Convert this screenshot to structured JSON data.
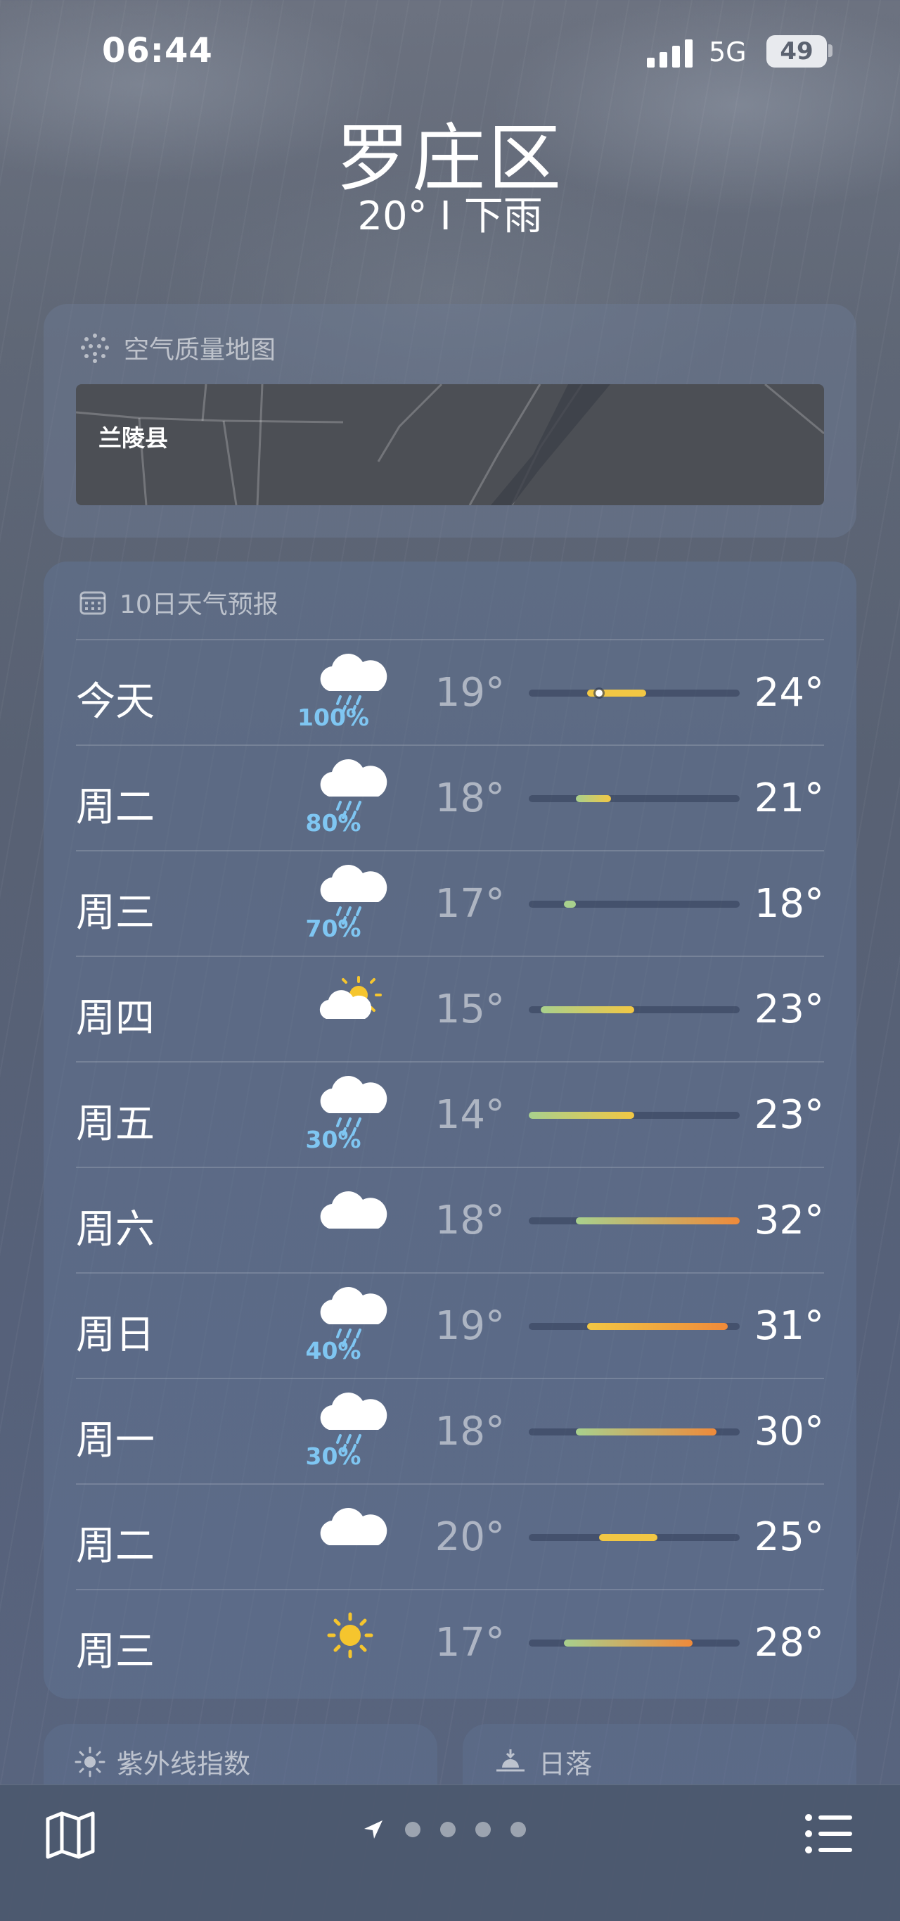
{
  "status": {
    "time": "06:44",
    "network": "5G",
    "battery": "49"
  },
  "location": {
    "city": "罗庄区",
    "condition": "20°  I  下雨"
  },
  "air_quality": {
    "title": "空气质量地图",
    "map_label": "兰陵县"
  },
  "forecast": {
    "title": "10日天气预报",
    "days": [
      {
        "day": "今天",
        "icon": "rain-cloud-icon",
        "precip": "100%",
        "low": "19°",
        "high": "24°"
      },
      {
        "day": "周二",
        "icon": "rain-cloud-icon",
        "precip": "80%",
        "low": "18°",
        "high": "21°"
      },
      {
        "day": "周三",
        "icon": "rain-cloud-icon",
        "precip": "70%",
        "low": "17°",
        "high": "18°"
      },
      {
        "day": "周四",
        "icon": "partly-sunny-icon",
        "precip": "",
        "low": "15°",
        "high": "23°"
      },
      {
        "day": "周五",
        "icon": "rain-cloud-icon",
        "precip": "30%",
        "low": "14°",
        "high": "23°"
      },
      {
        "day": "周六",
        "icon": "cloud-icon",
        "precip": "",
        "low": "18°",
        "high": "32°"
      },
      {
        "day": "周日",
        "icon": "rain-cloud-icon",
        "precip": "40%",
        "low": "19°",
        "high": "31°"
      },
      {
        "day": "周一",
        "icon": "rain-cloud-icon",
        "precip": "30%",
        "low": "18°",
        "high": "30°"
      },
      {
        "day": "周二",
        "icon": "cloud-icon",
        "precip": "",
        "low": "20°",
        "high": "25°"
      },
      {
        "day": "周三",
        "icon": "sun-icon",
        "precip": "",
        "low": "17°",
        "high": "28°"
      }
    ],
    "range_min": 14,
    "range_max": 32,
    "current_temp": 20
  },
  "bottom_cards": {
    "uv_title": "紫外线指数",
    "sunset_title": "日落"
  },
  "colors": {
    "precip": "#7fc6f2",
    "cool": "#a8d08d",
    "warm": "#f2c744",
    "hot": "#ef8a3a"
  }
}
